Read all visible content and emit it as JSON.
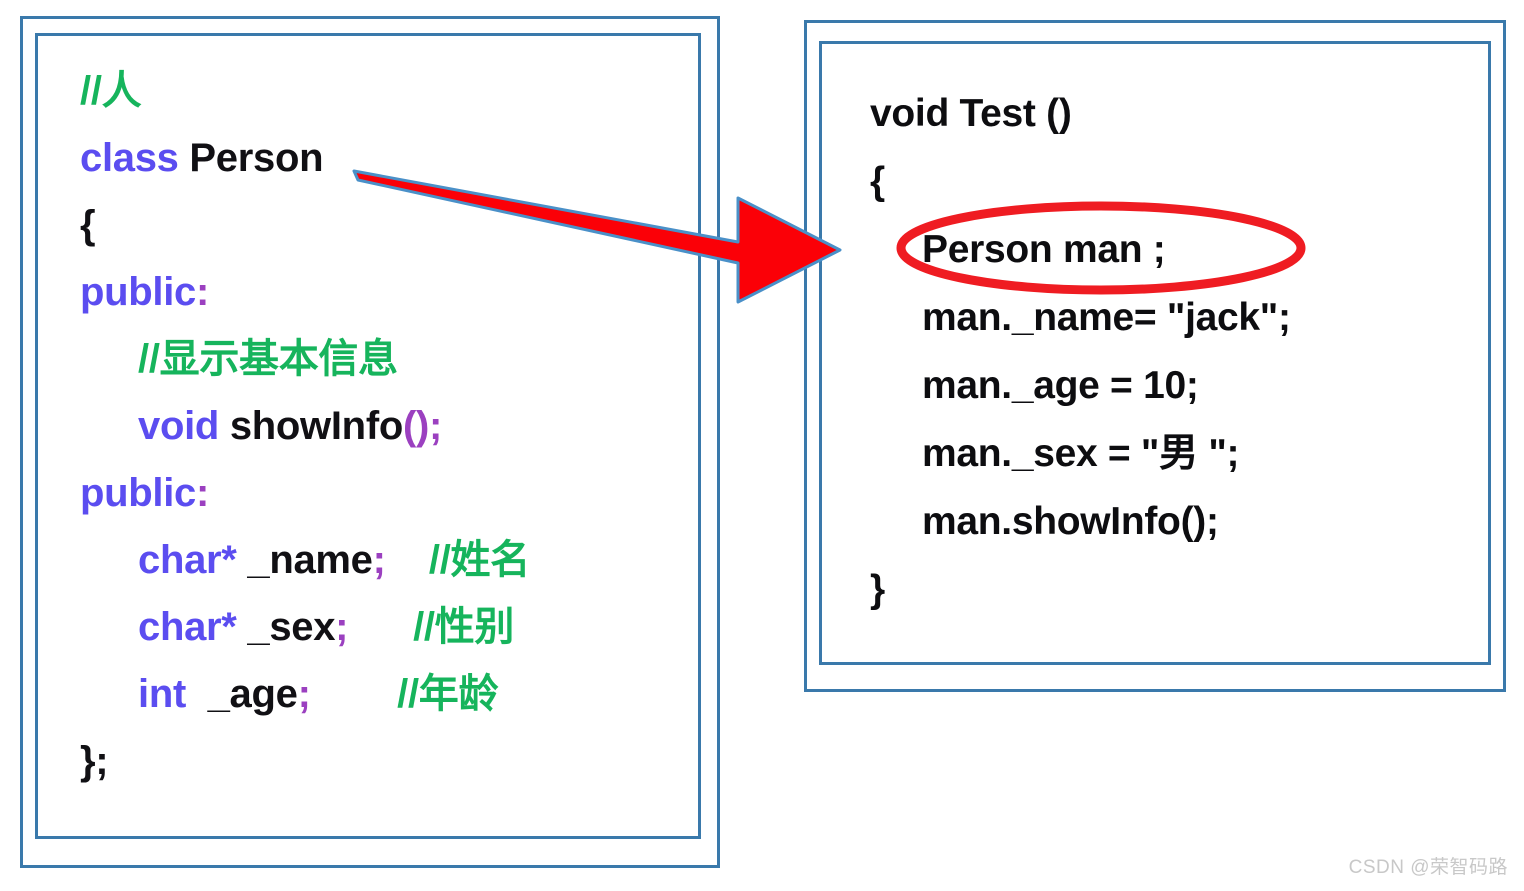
{
  "diagram": {
    "title": "C++ class definition and usage illustration",
    "colors": {
      "panel_border": "#3a79ab",
      "keyword": "#5b4df0",
      "comment": "#16b45c",
      "identifier": "#111014",
      "punctuation": "#9b40c0",
      "arrow_fill": "#fb0007",
      "arrow_outline": "#4a90c8",
      "ellipse_stroke": "#ef1c22",
      "watermark": "#c8c8c8",
      "background": "#ffffff"
    }
  },
  "left_panel": {
    "name": "class-definition-panel",
    "lines": [
      {
        "id": "l0",
        "indent": 0,
        "tokens": [
          {
            "text": "//人",
            "cls": "t-cmt"
          }
        ]
      },
      {
        "id": "l1",
        "indent": 0,
        "tokens": [
          {
            "text": "class ",
            "cls": "t-kw"
          },
          {
            "text": "Person",
            "cls": "t-id"
          }
        ]
      },
      {
        "id": "l2",
        "indent": 0,
        "tokens": [
          {
            "text": "{",
            "cls": "t-id"
          }
        ]
      },
      {
        "id": "l3",
        "indent": 0,
        "tokens": [
          {
            "text": "public",
            "cls": "t-kw"
          },
          {
            "text": ":",
            "cls": "t-punct"
          }
        ]
      },
      {
        "id": "l4",
        "indent": 1,
        "tokens": [
          {
            "text": "//显示基本信息",
            "cls": "t-cmt"
          }
        ]
      },
      {
        "id": "l5",
        "indent": 1,
        "tokens": [
          {
            "text": "void ",
            "cls": "t-kw"
          },
          {
            "text": "showInfo",
            "cls": "t-id"
          },
          {
            "text": "();",
            "cls": "t-punct"
          }
        ]
      },
      {
        "id": "l6",
        "indent": 0,
        "tokens": [
          {
            "text": "public",
            "cls": "t-kw"
          },
          {
            "text": ":",
            "cls": "t-punct"
          }
        ]
      },
      {
        "id": "l7",
        "indent": 1,
        "tokens": [
          {
            "text": "char*",
            "cls": "t-kw"
          },
          {
            "text": " _name",
            "cls": "t-id"
          },
          {
            "text": ";",
            "cls": "t-punct"
          },
          {
            "text": "    ",
            "cls": "t-plain"
          },
          {
            "text": "//姓名",
            "cls": "t-cmt"
          }
        ]
      },
      {
        "id": "l8",
        "indent": 1,
        "tokens": [
          {
            "text": "char*",
            "cls": "t-kw"
          },
          {
            "text": " _sex",
            "cls": "t-id"
          },
          {
            "text": ";",
            "cls": "t-punct"
          },
          {
            "text": "      ",
            "cls": "t-plain"
          },
          {
            "text": "//性别",
            "cls": "t-cmt"
          }
        ]
      },
      {
        "id": "l9",
        "indent": 1,
        "tokens": [
          {
            "text": "int",
            "cls": "t-kw"
          },
          {
            "text": "  _age",
            "cls": "t-id"
          },
          {
            "text": ";",
            "cls": "t-punct"
          },
          {
            "text": "        ",
            "cls": "t-plain"
          },
          {
            "text": "//年龄",
            "cls": "t-cmt"
          }
        ]
      },
      {
        "id": "l10",
        "indent": 0,
        "tokens": [
          {
            "text": "};",
            "cls": "t-id"
          }
        ]
      }
    ]
  },
  "right_panel": {
    "name": "test-function-panel",
    "lines": [
      {
        "id": "r0",
        "indent": 0,
        "text": "void Test ()"
      },
      {
        "id": "r1",
        "indent": 0,
        "text": "{"
      },
      {
        "id": "r2",
        "indent": 1,
        "text": "Person man ;"
      },
      {
        "id": "r3",
        "indent": 1,
        "text": "man._name= \"jack\";"
      },
      {
        "id": "r4",
        "indent": 1,
        "text": "man._age = 10;"
      },
      {
        "id": "r5",
        "indent": 1,
        "text": "man._sex = \"男 \";"
      },
      {
        "id": "r6",
        "indent": 1,
        "text": "man.showInfo();"
      },
      {
        "id": "r7",
        "indent": 0,
        "text": "}"
      }
    ]
  },
  "annotations": {
    "arrow": {
      "name": "red-arrow",
      "from_label": "class Person",
      "to_label": "Person man ;",
      "fill": "#fb0007",
      "outline": "#4a90c8"
    },
    "ellipse": {
      "name": "red-ellipse-highlight",
      "highlights": "Person man ;",
      "stroke": "#ef1c22"
    }
  },
  "watermark": {
    "text": "CSDN @荣智码路"
  }
}
